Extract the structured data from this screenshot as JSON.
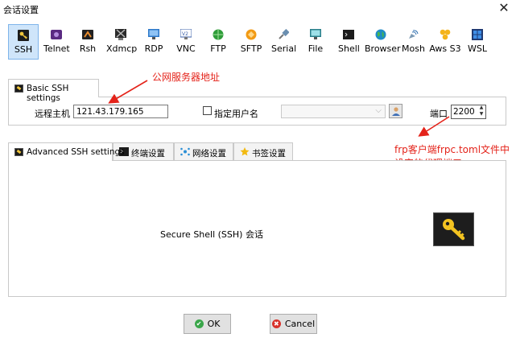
{
  "window": {
    "title": "会话设置",
    "close_glyph": "✕"
  },
  "protocols": [
    {
      "label": "SSH",
      "icon": "ssh-key-icon",
      "active": true
    },
    {
      "label": "Telnet",
      "icon": "telnet-icon"
    },
    {
      "label": "Rsh",
      "icon": "rsh-icon"
    },
    {
      "label": "Xdmcp",
      "icon": "xdmcp-icon"
    },
    {
      "label": "RDP",
      "icon": "rdp-monitor-icon"
    },
    {
      "label": "VNC",
      "icon": "vnc-icon"
    },
    {
      "label": "FTP",
      "icon": "ftp-globe-icon"
    },
    {
      "label": "SFTP",
      "icon": "sftp-icon"
    },
    {
      "label": "Serial",
      "icon": "serial-plug-icon"
    },
    {
      "label": "File",
      "icon": "file-monitor-icon"
    },
    {
      "label": "Shell",
      "icon": "shell-terminal-icon"
    },
    {
      "label": "Browser",
      "icon": "browser-globe-icon"
    },
    {
      "label": "Mosh",
      "icon": "mosh-satellite-icon"
    },
    {
      "label": "Aws S3",
      "icon": "aws-s3-icon"
    },
    {
      "label": "WSL",
      "icon": "wsl-windows-icon"
    }
  ],
  "basic": {
    "tab_label": "Basic SSH settings",
    "remote_host_label": "远程主机 *",
    "remote_host_value": "121.43.179.165",
    "specify_user_label": "指定用户名",
    "specify_user_checked": false,
    "username_value": "",
    "port_label": "端口",
    "port_value": "2200"
  },
  "annotations": {
    "host_note": "公网服务器地址",
    "port_note": "frp客户端frpc.toml文件中设定的代理端口",
    "color": "#e4231a"
  },
  "advanced_tabs": [
    {
      "label": "Advanced SSH settings",
      "icon": "ssh-key-icon",
      "active": true
    },
    {
      "label": "终端设置",
      "icon": "terminal-icon"
    },
    {
      "label": "网络设置",
      "icon": "network-icon"
    },
    {
      "label": "书签设置",
      "icon": "star-icon"
    }
  ],
  "advanced": {
    "description": "Secure Shell (SSH) 会话"
  },
  "buttons": {
    "ok_label": "OK",
    "cancel_label": "Cancel"
  }
}
